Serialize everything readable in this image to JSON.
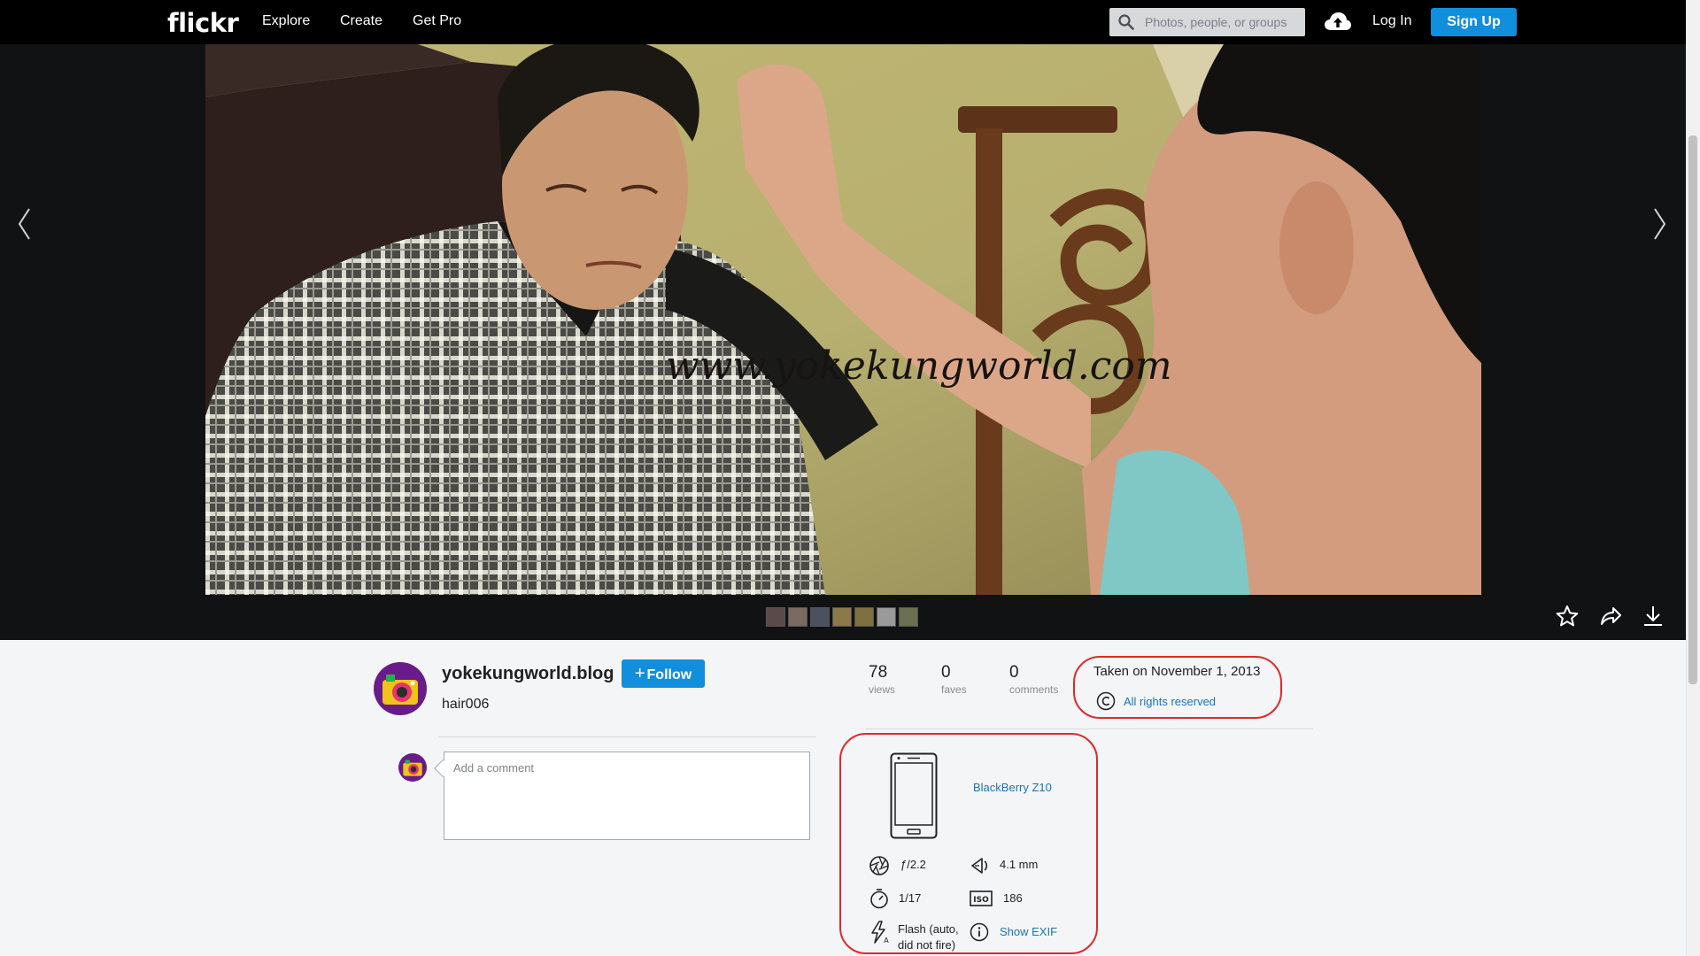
{
  "nav": {
    "logo": "flickr",
    "links": [
      "Explore",
      "Create",
      "Get Pro"
    ],
    "search_placeholder": "Photos, people, or groups",
    "login": "Log In",
    "signup": "Sign Up"
  },
  "photo": {
    "watermark": "www.yokekungworld.com",
    "thumbnail_count": 7
  },
  "owner": {
    "name": "yokekungworld.blog",
    "follow_label": "Follow",
    "photo_title": "hair006"
  },
  "comment": {
    "placeholder": "Add a comment"
  },
  "stats": {
    "views": {
      "value": "78",
      "label": "views"
    },
    "faves": {
      "value": "0",
      "label": "faves"
    },
    "comments": {
      "value": "0",
      "label": "comments"
    }
  },
  "meta": {
    "taken": "Taken on November 1, 2013",
    "rights": "All rights reserved"
  },
  "exif": {
    "camera": "BlackBerry Z10",
    "aperture": "ƒ/2.2",
    "focal_length": "4.1 mm",
    "shutter": "1/17",
    "iso": "186",
    "flash": "Flash (auto, did not fire)",
    "show_exif": "Show EXIF"
  },
  "colors": {
    "accent": "#128fdc",
    "link": "#1b74b5",
    "annotation": "#e0292c"
  }
}
